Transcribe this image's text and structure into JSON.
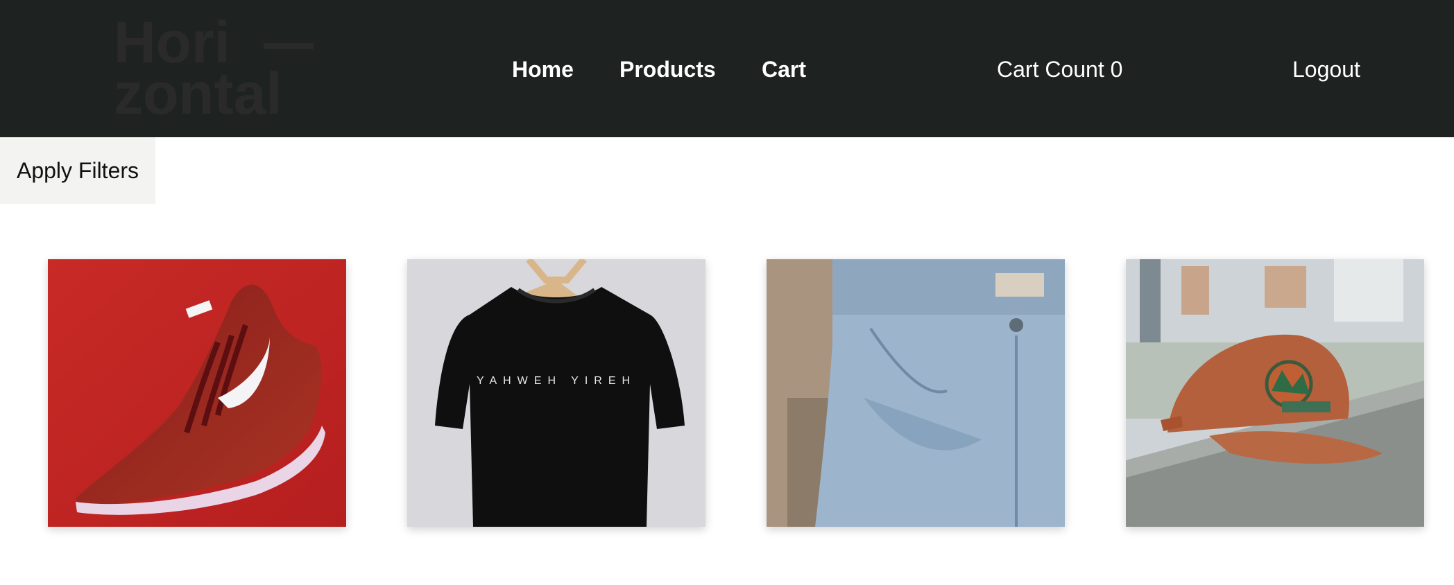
{
  "nav": {
    "logo_lines": [
      "Hori",
      "zontal"
    ],
    "links": [
      {
        "label": "Home"
      },
      {
        "label": "Products"
      },
      {
        "label": "Cart"
      }
    ],
    "cart_count_label": "Cart Count 0",
    "logout_label": "Logout"
  },
  "filters": {
    "label": "Apply Filters"
  },
  "colors": {
    "navbar_bg": "#1e2321",
    "nav_text": "#ffffff",
    "filter_btn_bg": "#f3f3f1",
    "logo_text": "#2a2a2a"
  },
  "products": [
    {
      "image_icon": "sneaker-image",
      "description": "red Nike running shoe",
      "shirt_print": ""
    },
    {
      "image_icon": "tshirt-image",
      "description": "black t-shirt on hanger",
      "shirt_print": "YAHWEH YIREH"
    },
    {
      "image_icon": "jeans-image",
      "description": "light blue denim jeans",
      "shirt_print": ""
    },
    {
      "image_icon": "cap-image",
      "description": "orange baseball cap",
      "shirt_print": ""
    }
  ]
}
